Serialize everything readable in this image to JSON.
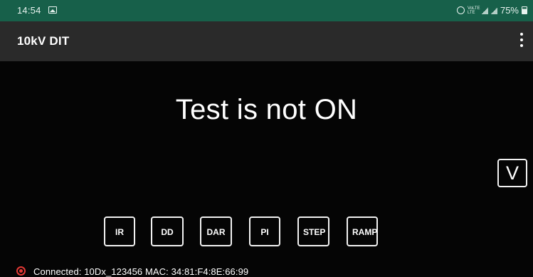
{
  "status_bar": {
    "time": "14:54",
    "network": "VoLTE LTE",
    "battery": "75%"
  },
  "app_bar": {
    "title": "10kV DIT",
    "menu_icon": "more-vertical-icon"
  },
  "main": {
    "message": "Test is not ON",
    "unit_button": "V"
  },
  "test_modes": [
    "IR",
    "DD",
    "DAR",
    "PI",
    "STEP",
    "RAMP"
  ],
  "connection": {
    "status_icon": "connected-indicator-icon",
    "text": "Connected: 10Dx_123456 MAC: 34:81:F4:8E:66:99"
  },
  "colors": {
    "status_bar_background": "#17604a",
    "app_bar_background": "#2a2a2a",
    "screen_background": "#050505",
    "button_outline": "#f2f2f2",
    "connected_indicator": "#e53935"
  }
}
